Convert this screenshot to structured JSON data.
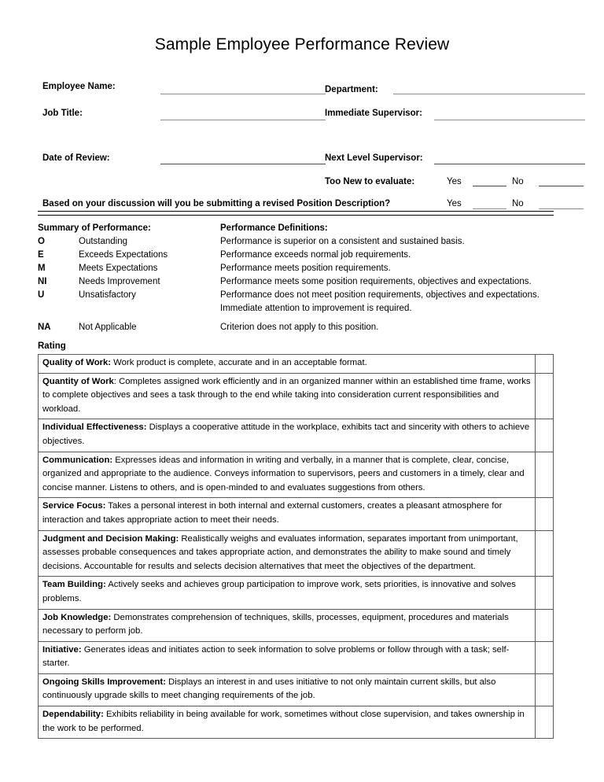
{
  "document": {
    "title": "Sample Employee Performance Review"
  },
  "form": {
    "employee_name_label": "Employee Name:",
    "employee_name_value": "",
    "department_label": "Department:",
    "department_value": "",
    "job_title_label": "Job Title:",
    "job_title_value": "",
    "immediate_supervisor_label": "Immediate Supervisor:",
    "immediate_supervisor_value": "",
    "date_of_review_label": "Date of Review:",
    "date_of_review_value": "",
    "next_level_supervisor_label": "Next Level Supervisor:",
    "next_level_supervisor_value": "",
    "too_new_label": "Too New to evaluate:",
    "too_new_yes_label": "Yes",
    "too_new_yes_value": "",
    "too_new_no_label": "No",
    "too_new_no_value": "",
    "revised_pd_question": "Based on your discussion will you be submitting a revised Position Description?",
    "revised_pd_yes_label": "Yes",
    "revised_pd_yes_value": "",
    "revised_pd_no_label": "No",
    "revised_pd_no_value": ""
  },
  "summary": {
    "left_heading": "Summary of Performance:",
    "right_heading": "Performance Definitions:",
    "rows": [
      {
        "code": "O",
        "label": "Outstanding",
        "definition": "Performance is superior on a consistent and sustained basis."
      },
      {
        "code": "E",
        "label": "Exceeds Expectations",
        "definition": "Performance exceeds normal job requirements."
      },
      {
        "code": "M",
        "label": "Meets Expectations",
        "definition": "Performance meets position requirements."
      },
      {
        "code": "NI",
        "label": "Needs Improvement",
        "definition": "Performance meets some position requirements, objectives and expectations."
      },
      {
        "code": "U",
        "label": "Unsatisfactory",
        "definition": "Performance does not meet position requirements, objectives and expectations."
      },
      {
        "code": "",
        "label": "",
        "definition": "Immediate attention to improvement is required."
      },
      {
        "code": "NA",
        "label": "Not Applicable",
        "definition": "Criterion does not apply to this position."
      }
    ]
  },
  "rating": {
    "section_label": "Rating",
    "criteria": [
      {
        "name": "Quality of Work:",
        "description": " Work product is complete, accurate and in an acceptable format.",
        "score": ""
      },
      {
        "name": "Quantity of Work",
        "description": ": Completes assigned work efficiently and in an organized manner within an established time frame, works to complete objectives and sees a task through to the end while taking into consideration current responsibilities and workload.",
        "score": ""
      },
      {
        "name": "Individual Effectiveness:",
        "description": " Displays a cooperative attitude in the workplace, exhibits tact and sincerity with others to achieve objectives.",
        "score": ""
      },
      {
        "name": "Communication:",
        "description": " Expresses ideas and information in writing and verbally, in a manner that is complete, clear, concise, organized and appropriate to the audience.  Conveys information to supervisors, peers and customers in a timely, clear and concise manner.  Listens to others, and is open-minded to and evaluates suggestions from others.",
        "score": ""
      },
      {
        "name": "Service Focus:",
        "description": " Takes a personal interest in both internal and external customers, creates a pleasant atmosphere for interaction and takes appropriate action to meet their needs.",
        "score": ""
      },
      {
        "name": "Judgment and Decision Making:",
        "description": "  Realistically weighs and evaluates information, separates important from unimportant, assesses probable consequences and takes appropriate action, and demonstrates the ability to make sound and timely decisions.  Accountable for results and selects decision alternatives that meet the objectives of the department.",
        "score": ""
      },
      {
        "name": "Team Building:",
        "description": " Actively seeks and achieves group participation to improve work, sets priorities, is innovative and solves problems.",
        "score": ""
      },
      {
        "name": "Job Knowledge:",
        "description": " Demonstrates comprehension of techniques, skills, processes, equipment, procedures and materials necessary to perform job.",
        "score": ""
      },
      {
        "name": "Initiative:",
        "description": " Generates ideas and initiates action to seek information to solve problems or follow through with a task; self-starter.",
        "score": ""
      },
      {
        "name": "Ongoing Skills Improvement:",
        "description": " Displays an interest in and uses initiative to not only maintain current skills, but also continuously upgrade skills to meet changing requirements of the job.",
        "score": ""
      },
      {
        "name": "Dependability:",
        "description": " Exhibits reliability in being available for work, sometimes without close supervision, and takes ownership in the work to be performed.",
        "score": ""
      }
    ]
  },
  "colors": {
    "text": "#000000",
    "rule": "#8c8c8c",
    "table_border": "#595959",
    "page_background": "#ffffff"
  }
}
